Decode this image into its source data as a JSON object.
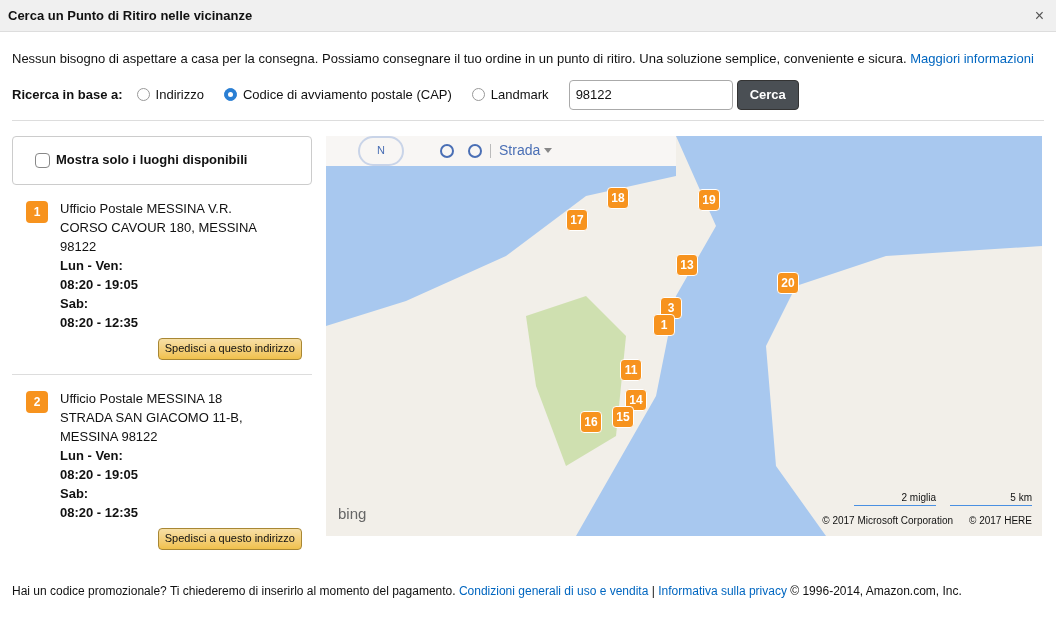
{
  "dialog": {
    "title": "Cerca un Punto di Ritiro nelle vicinanze",
    "close": "×"
  },
  "intro": {
    "text": "Nessun bisogno di aspettare a casa per la consegna. Possiamo consegnare il tuo ordine in un punto di ritiro. Una soluzione semplice, conveniente e sicura.",
    "link": "Maggiori informazioni"
  },
  "search": {
    "label": "Ricerca in base a:",
    "options": [
      {
        "label": "Indirizzo",
        "selected": false
      },
      {
        "label": "Codice di avviamento postale (CAP)",
        "selected": true
      },
      {
        "label": "Landmark",
        "selected": false
      }
    ],
    "value": "98122",
    "button": "Cerca"
  },
  "filter": {
    "label": "Mostra solo i luoghi disponibili",
    "checked": false
  },
  "locations": [
    {
      "number": "1",
      "name": "Ufficio Postale MESSINA V.R.",
      "address": [
        "CORSO CAVOUR 180, MESSINA",
        "98122"
      ],
      "hours": [
        "Lun - Ven:",
        "08:20 - 19:05",
        "Sab:",
        "08:20 - 12:35"
      ],
      "button": "Spedisci a questo indirizzo"
    },
    {
      "number": "2",
      "name": "Ufficio Postale MESSINA 18",
      "address": [
        "STRADA SAN GIACOMO 11-B,",
        "MESSINA 98122"
      ],
      "hours": [
        "Lun - Ven:",
        "08:20 - 19:05",
        "Sab:",
        "08:20 - 12:35"
      ],
      "button": "Spedisci a questo indirizzo"
    }
  ],
  "map": {
    "compass": "N",
    "view": "Strada",
    "pins": [
      "18",
      "19",
      "17",
      "13",
      "20",
      "3",
      "1",
      "11",
      "14",
      "16",
      "15"
    ],
    "logo": "bing",
    "scale": [
      "2 miglia",
      "5 km"
    ],
    "copyright": [
      "© 2017 Microsoft Corporation",
      "© 2017 HERE"
    ]
  },
  "footer": {
    "text": "Hai un codice promozionale? Ti chiederemo di inserirlo al momento del pagamento.",
    "links": [
      "Condizioni generali di uso e vendita",
      "Informativa sulla privacy"
    ],
    "separator": "|",
    "copyright": "© 1996-2014, Amazon.com, Inc."
  }
}
